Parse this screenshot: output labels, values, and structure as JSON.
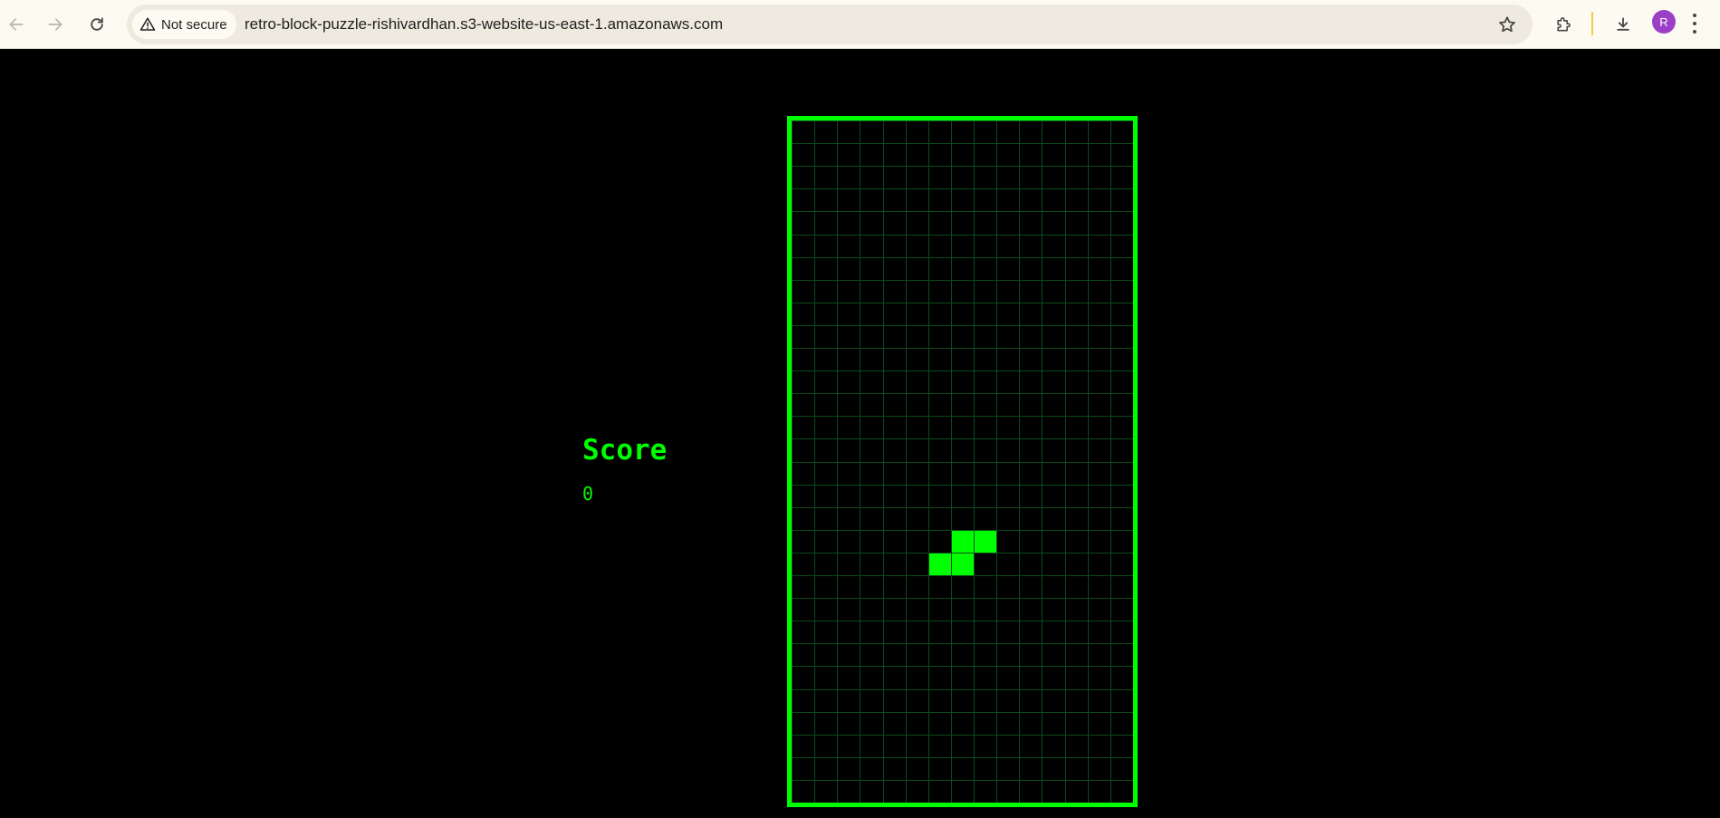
{
  "browser": {
    "security_label": "Not secure",
    "url": "retro-block-puzzle-rishivardhan.s3-website-us-east-1.amazonaws.com",
    "profile_initial": "R",
    "icons": [
      "back-arrow-icon",
      "forward-arrow-icon",
      "reload-icon",
      "warning-icon",
      "star-icon",
      "extensions-icon",
      "download-icon",
      "more-menu-icon"
    ]
  },
  "game": {
    "score_label": "Score",
    "score_value": "0",
    "board": {
      "columns": 15,
      "rows": 30,
      "active_piece": {
        "shape": "S",
        "cells": [
          [
            7,
            18
          ],
          [
            8,
            18
          ],
          [
            6,
            19
          ],
          [
            7,
            19
          ]
        ]
      }
    },
    "colors": {
      "accent": "#00ff00",
      "grid_line": "#0b4a1a",
      "background": "#000000"
    }
  }
}
